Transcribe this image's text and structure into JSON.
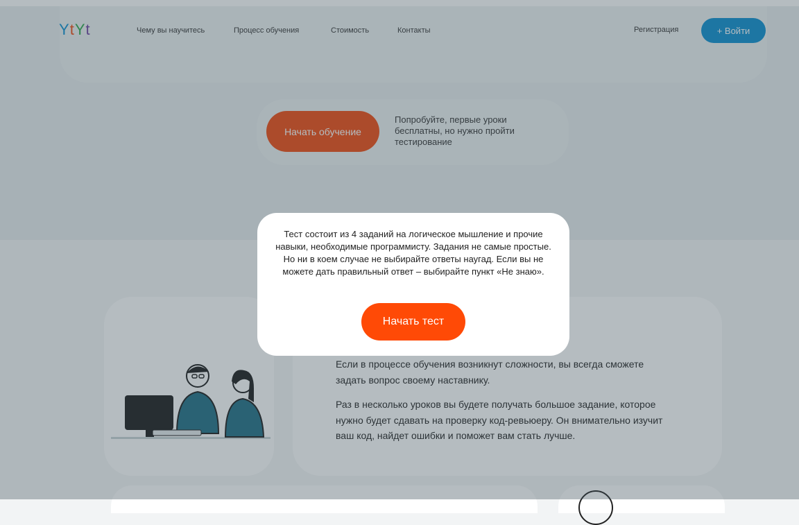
{
  "header": {
    "logo_letters": [
      "Y",
      "t",
      "Y",
      "t"
    ],
    "logo_colors": [
      "#0a8fd1",
      "#f04a0f",
      "#2aa84a",
      "#6b3fa0"
    ],
    "nav": [
      "Чему вы научитесь",
      "Процесс обучения",
      "Стоимость",
      "Контакты"
    ],
    "register": "Регистрация",
    "login": "+ Войти"
  },
  "hero": {
    "cta_button": "Начать обучение",
    "cta_note": "Попробуйте, первые уроки бесплатны, но нужно пройти тестирование"
  },
  "content": {
    "paragraphs": [
      "Если в процессе обучения возникнут сложности, вы всегда сможете задать вопрос своему наставнику.",
      "Раз в несколько уроков вы будете получать большое задание, которое нужно будет сдавать на проверку код-ревьюеру. Он внимательно изучит ваш код, найдет ошибки и поможет вам стать лучше."
    ]
  },
  "modal": {
    "text": "Тест состоит из 4 заданий на логическое мышление и прочие навыки, необходимые программисту. Задания не самые простые. Но ни в коем случае не выбирайте ответы наугад. Если вы не можете дать правильный ответ – выбирайте пункт «Не знаю».",
    "button": "Начать тест"
  },
  "colors": {
    "accent_orange": "#ff4a06",
    "accent_blue": "#0a8fd1"
  }
}
